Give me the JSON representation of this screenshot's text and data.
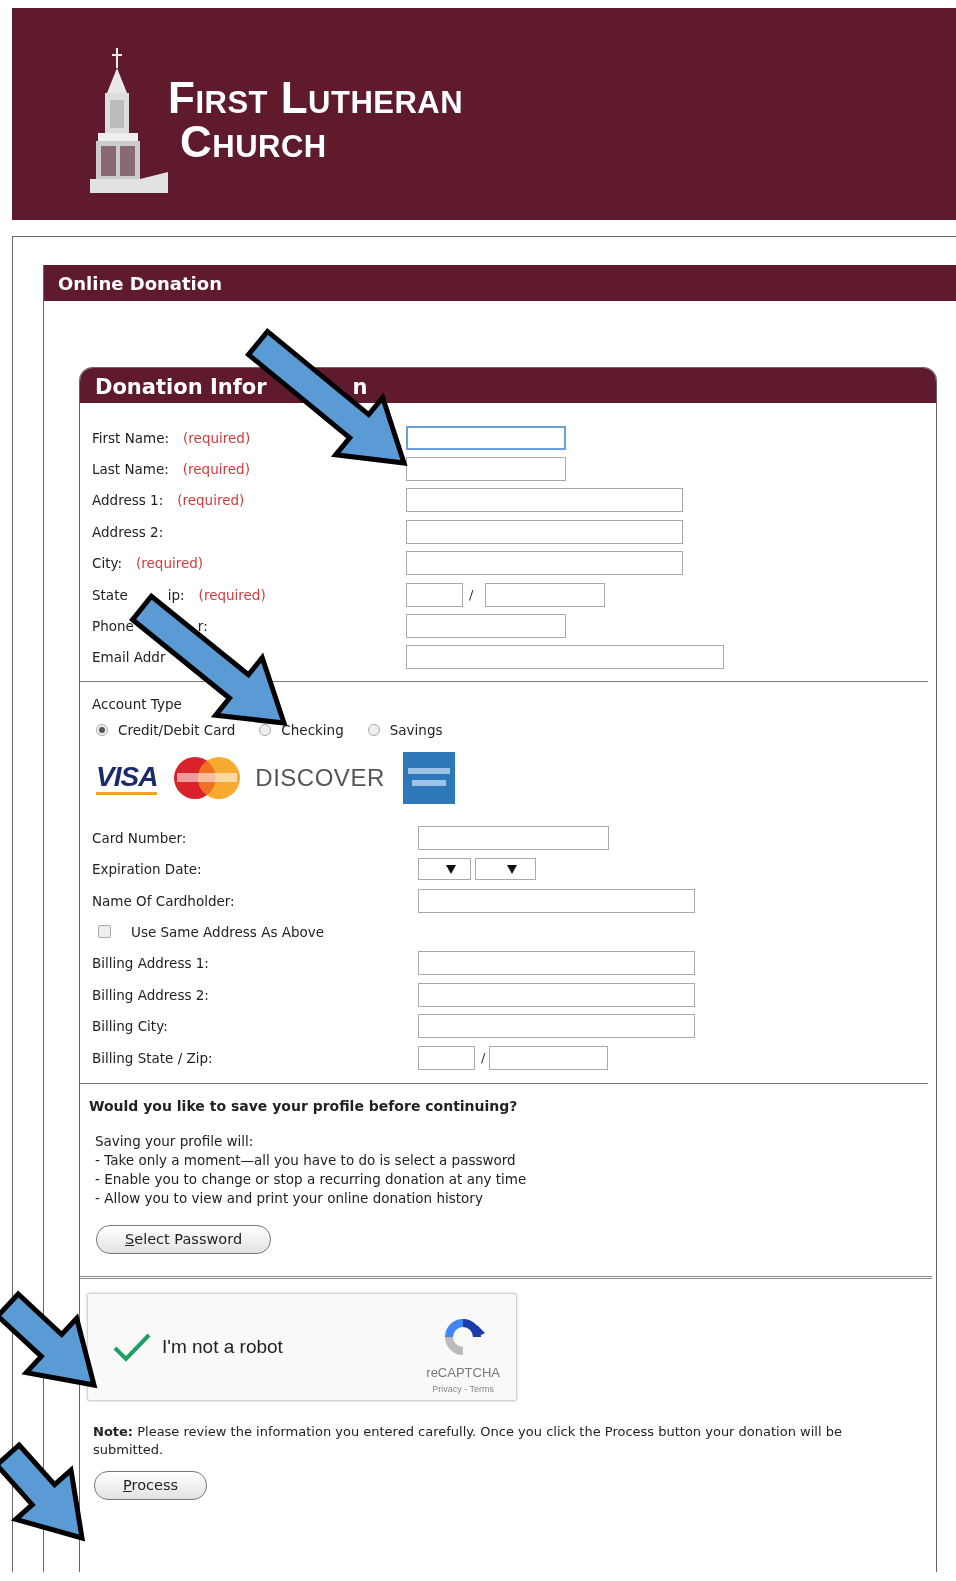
{
  "header": {
    "logo_lines": [
      "First Lutheran",
      "Church"
    ]
  },
  "panel": {
    "title": "Online Donation"
  },
  "donation_info": {
    "title_parts": [
      "Donation Infor",
      "n"
    ],
    "fields": [
      {
        "label_parts": [
          "First Name:"
        ],
        "note": "(required)",
        "kind": "medium",
        "focused": true
      },
      {
        "label_parts": [
          "Last Name:"
        ],
        "note": "(required)",
        "kind": "medium",
        "focused": false
      },
      {
        "label_parts": [
          "Address 1:"
        ],
        "note": "(required)",
        "kind": "long",
        "focused": false
      },
      {
        "label_parts": [
          "Address 2:"
        ],
        "kind": "long",
        "focused": false
      },
      {
        "label_parts": [
          "City:"
        ],
        "note": "(required)",
        "kind": "long",
        "focused": false
      },
      {
        "label_parts": [
          "State",
          "ip:"
        ],
        "note": "(required)",
        "kind": "state_zip",
        "separator": "/",
        "focused": false
      },
      {
        "label_parts": [
          "Phone",
          "r:"
        ],
        "kind": "medium",
        "focused": false
      },
      {
        "label_parts": [
          "Email Addr"
        ],
        "kind": "wide",
        "focused": false
      }
    ],
    "account_type": {
      "label": "Account Type",
      "options": [
        {
          "label": "Credit/Debit Card",
          "selected": true
        },
        {
          "label": "Checking",
          "selected": false
        },
        {
          "label": "Savings",
          "selected": false
        }
      ]
    },
    "card_logos": [
      {
        "kind": "visa",
        "text": "VISA"
      },
      {
        "kind": "mastercard"
      },
      {
        "kind": "discover",
        "text": "DISCOVER"
      },
      {
        "kind": "amex"
      }
    ],
    "card_fields": [
      {
        "kind": "medium",
        "label": "Card Number:"
      },
      {
        "kind": "expiry",
        "label": "Expiration Date:"
      },
      {
        "kind": "long",
        "label": "Name Of Cardholder:"
      },
      {
        "kind": "checkbox",
        "label": "Use Same Address As Above",
        "checked": false
      },
      {
        "kind": "long",
        "label": "Billing Address 1:"
      },
      {
        "kind": "long",
        "label": "Billing Address 2:"
      },
      {
        "kind": "long",
        "label": "Billing City:"
      },
      {
        "kind": "state_zip",
        "label": "Billing State / Zip:",
        "separator": "/"
      }
    ],
    "profile": {
      "question": "Would you like to save your profile before continuing?",
      "intro": "Saving your profile will:",
      "points": [
        "- Take only a moment—all you have to do is select a password",
        "- Enable you to change or stop a recurring donation at any time",
        "- Allow you to view and print your online donation history"
      ],
      "button": "Select Password"
    },
    "captcha": {
      "label": "I'm not a robot",
      "checked": true,
      "brand": "reCAPTCHA",
      "links": "Privacy - Terms"
    },
    "note": "**Note:** Please review the information you entered carefully. Once you click the Process button your donation will be submitted.",
    "process_button": "Process"
  }
}
